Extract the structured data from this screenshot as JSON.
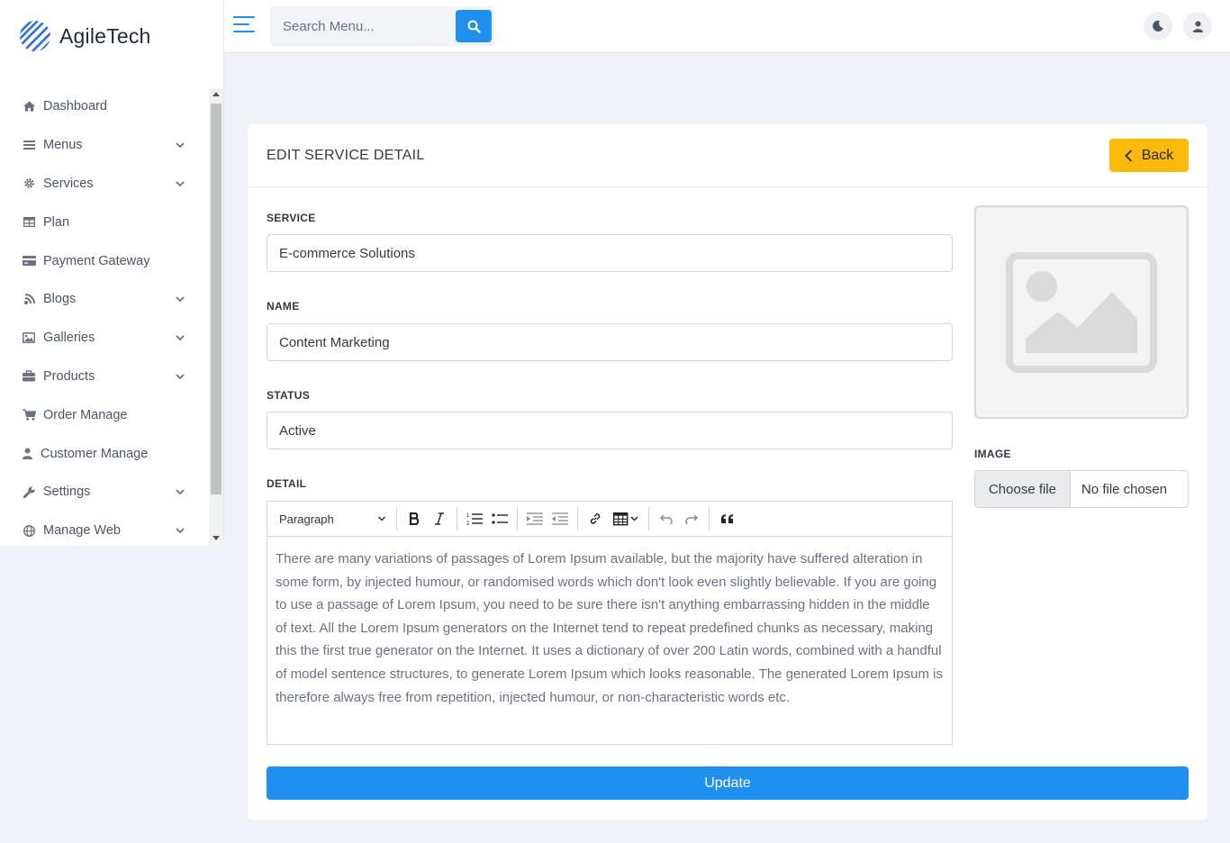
{
  "brand": {
    "name": "AgileTech",
    "accent": "#1f8ff0"
  },
  "sidebar": {
    "items": [
      {
        "label": "Dashboard",
        "icon": "home-icon",
        "has_children": false
      },
      {
        "label": "Menus",
        "icon": "bars-icon",
        "has_children": true
      },
      {
        "label": "Services",
        "icon": "gear-icon",
        "has_children": true
      },
      {
        "label": "Plan",
        "icon": "table-icon",
        "has_children": false
      },
      {
        "label": "Payment Gateway",
        "icon": "credit-card-icon",
        "has_children": false
      },
      {
        "label": "Blogs",
        "icon": "blog-icon",
        "has_children": true
      },
      {
        "label": "Galleries",
        "icon": "image-icon",
        "has_children": true
      },
      {
        "label": "Products",
        "icon": "briefcase-icon",
        "has_children": true
      },
      {
        "label": "Order Manage",
        "icon": "cart-icon",
        "has_children": false
      },
      {
        "label": "Customer Manage",
        "icon": "user-icon",
        "has_children": false
      },
      {
        "label": "Settings",
        "icon": "wrench-icon",
        "has_children": true
      },
      {
        "label": "Manage Web",
        "icon": "globe-icon",
        "has_children": true
      }
    ]
  },
  "header": {
    "search_placeholder": "Search Menu...",
    "icons": [
      "menu-toggle-icon",
      "search-icon",
      "moon-icon",
      "user-icon"
    ]
  },
  "card": {
    "title": "EDIT SERVICE DETAIL",
    "back_label": "Back",
    "back_color": "#fcb90a",
    "fields": {
      "service_label": "SERVICE",
      "service_value": "E-commerce Solutions",
      "name_label": "NAME",
      "name_value": "Content Marketing",
      "status_label": "STATUS",
      "status_value": "Active",
      "detail_label": "DETAIL",
      "image_label": "IMAGE"
    },
    "editor": {
      "paragraph_style": "Paragraph",
      "content": "There are many variations of passages of Lorem Ipsum available, but the majority have suffered alteration in some form, by injected humour, or randomised words which don't look even slightly believable. If you are going to use a passage of Lorem Ipsum, you need to be sure there isn't anything embarrassing hidden in the middle of text. All the Lorem Ipsum generators on the Internet tend to repeat predefined chunks as necessary, making this the first true generator on the Internet. It uses a dictionary of over 200 Latin words, combined with a handful of model sentence structures, to generate Lorem Ipsum which looks reasonable. The generated Lorem Ipsum is therefore always free from repetition, injected humour, or non-characteristic words etc."
    },
    "file": {
      "choose_label": "Choose file",
      "status": "No file chosen"
    },
    "update_label": "Update"
  }
}
